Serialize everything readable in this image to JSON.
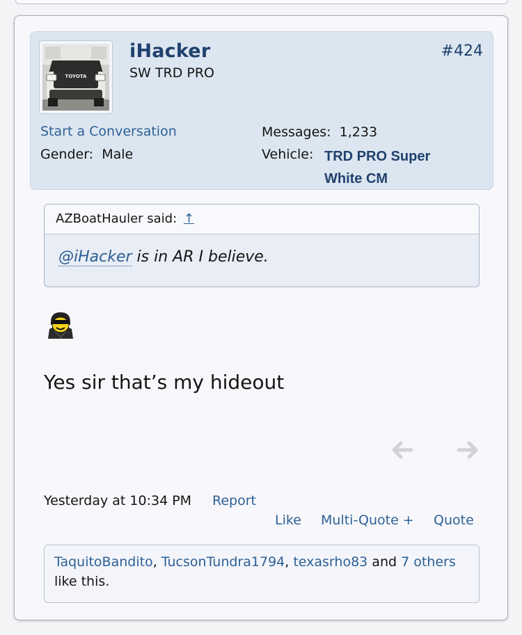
{
  "post": {
    "author": {
      "username": "iHacker",
      "user_title": "SW TRD PRO",
      "start_conversation": "Start a Conversation",
      "gender_label": "Gender:",
      "gender_value": "Male",
      "messages_label": "Messages:",
      "messages_value": "1,233",
      "vehicle_label": "Vehicle:",
      "vehicle_value": "TRD PRO Super White CM",
      "avatar_brand_text": "TOYOTA"
    },
    "post_number": "#424",
    "quote": {
      "author_said": "AZBoatHauler said:",
      "arrow": "↑",
      "mention": "@iHacker",
      "text": " is in AR I believe."
    },
    "body_text": "Yes sir that’s my hideout",
    "smiley_icon": "ninja-sunglasses-smiley-icon",
    "footer": {
      "date": "Yesterday at 10:34 PM",
      "report": "Report",
      "like": "Like",
      "multi_quote": "Multi-Quote +",
      "quote": "Quote"
    },
    "likes": {
      "users": [
        "TaquitoBandito",
        "TucsonTundra1794",
        "texasrho83"
      ],
      "separator": ", ",
      "and_text": " and ",
      "others": "7 others",
      "suffix": "like this."
    }
  },
  "colors": {
    "link": "#2d5f95",
    "username": "#20416e",
    "user_block_bg": "#dce6f0",
    "quote_bg": "#e9edf5"
  }
}
